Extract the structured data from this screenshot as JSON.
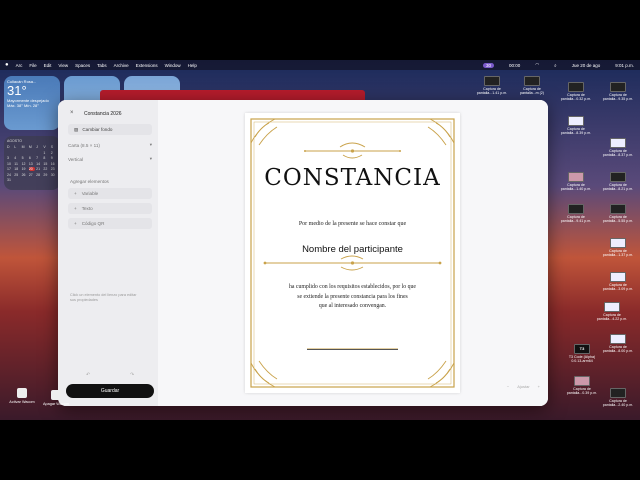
{
  "menubar": {
    "items": [
      "Arc",
      "File",
      "Edit",
      "View",
      "Spaces",
      "Tabs",
      "Archive",
      "Extensions",
      "Window",
      "Help"
    ],
    "right_pill": "30",
    "clock": "00:00",
    "date": "Jue 20 de ago",
    "time": "9:01 p.m."
  },
  "weather": {
    "city": "Culiacán Rosa...",
    "temp": "31°",
    "condition": "Mayormente despejado",
    "range": "Máx. 38° Mín. 28°"
  },
  "calendar": {
    "month": "AGOSTO",
    "weekdays": [
      "D",
      "L",
      "M",
      "M",
      "J",
      "V",
      "S"
    ],
    "days": [
      "",
      "",
      "",
      "",
      "",
      "1",
      "2",
      "3",
      "4",
      "5",
      "6",
      "7",
      "8",
      "9",
      "10",
      "11",
      "12",
      "13",
      "14",
      "15",
      "16",
      "17",
      "18",
      "19",
      "20",
      "21",
      "22",
      "23",
      "24",
      "25",
      "26",
      "27",
      "28",
      "29",
      "30",
      "31"
    ],
    "today": "20"
  },
  "editor": {
    "title": "Constancia 2026",
    "change_bg": "Cambiar fondo",
    "paper_size": "Carta (8.5 × 11)",
    "orientation": "Vertical",
    "add_elements_label": "Agregar elementos",
    "elements": [
      "Variable",
      "Texto",
      "Código QR"
    ],
    "hint": "Click un elemento del lienzo para editar sus propiedades",
    "undo": "↶",
    "redo": "↷",
    "save": "Guardar",
    "zoom_label": "Ajustar",
    "zoom_out": "−",
    "zoom_in": "+"
  },
  "certificate": {
    "title": "CONSTANCIA",
    "intro": "Por medio de la presente se hace constar que",
    "name": "Nombre del participante",
    "body_lines": [
      "ha cumplido con los requisitos establecidos, por lo que",
      "se extiende la presente constancia para los fines",
      "que al interesado convengan."
    ]
  },
  "desktop_files": [
    {
      "label": "Captura de pantalla...1.41 p.m.",
      "thumb": "dark"
    },
    {
      "label": "Captura de pantalla...m (2)",
      "thumb": "dark"
    },
    {
      "label": "Captura de pantalla...0.32 p.m.",
      "thumb": "dark"
    },
    {
      "label": "Captura de pantalla...9.35 p.m.",
      "thumb": "dark"
    },
    {
      "label": "Captura de pantalla...8.39 p.m.",
      "thumb": "light"
    },
    {
      "label": "Captura de pantalla...8.37 p.m.",
      "thumb": "light"
    },
    {
      "label": "Captura de pantalla...1.40 p.m.",
      "thumb": "pink"
    },
    {
      "label": "Captura de pantalla...8.21 p.m.",
      "thumb": "dark"
    },
    {
      "label": "Captura de pantalla...9.41 p.m.",
      "thumb": "dark"
    },
    {
      "label": "Captura de pantalla...5.55 p.m.",
      "thumb": "dark"
    },
    {
      "label": "Captura de pantalla...1.37 p.m.",
      "thumb": "light"
    },
    {
      "label": "Captura de pantalla...3.09 p.m.",
      "thumb": "light"
    },
    {
      "label": "Captura de pantalla...4.22 p.m.",
      "thumb": "light"
    },
    {
      "label": "Captura de pantalla...8.00 p.m.",
      "thumb": "light"
    },
    {
      "label": "T3 Code (Alpha) 0.0.13-arm64",
      "thumb": "t3"
    },
    {
      "label": "Captura de pantalla...0.39 p.m.",
      "thumb": "pink"
    },
    {
      "label": "Captura de pantalla...2.40 p.m.",
      "thumb": "dark"
    }
  ],
  "desktop_icons": {
    "left1": "Activar Wacom",
    "left2": "Apagar Wacom"
  },
  "colors": {
    "gold": "#c9a24a",
    "save_button": "#111111",
    "accent_red": "#b51c2c"
  }
}
